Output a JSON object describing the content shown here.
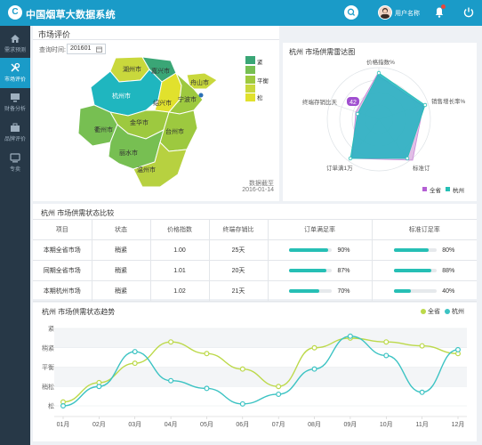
{
  "header": {
    "logo_glyph": "C",
    "title": "中国烟草大数据系统",
    "username": "用户名称",
    "accent": "#1a9bc8"
  },
  "sidebar": {
    "items": [
      {
        "label": "需求预测",
        "icon": "home-icon",
        "active": false
      },
      {
        "label": "市场评价",
        "icon": "tools-icon",
        "active": true
      },
      {
        "label": "财备分析",
        "icon": "monitor-icon",
        "active": false
      },
      {
        "label": "品牌评价",
        "icon": "briefcase-icon",
        "active": false
      },
      {
        "label": "专卖",
        "icon": "display-icon",
        "active": false
      }
    ]
  },
  "section": {
    "title": "市场评价"
  },
  "query": {
    "label": "查询时间:",
    "value": "201601"
  },
  "map": {
    "regions": [
      "湖州市",
      "嘉兴市",
      "杭州市",
      "舟山市",
      "绍兴市",
      "宁波市",
      "金华市",
      "衢州市",
      "台州市",
      "丽水市",
      "温州市"
    ],
    "legend": [
      {
        "label": "紧",
        "color": "#3aa676"
      },
      {
        "label": "",
        "color": "#77bf52"
      },
      {
        "label": "平衡",
        "color": "#9dc93f"
      },
      {
        "label": "",
        "color": "#c9d83c"
      },
      {
        "label": "松",
        "color": "#e1e12d"
      }
    ],
    "footer_label": "数据截至",
    "footer_date": "2016-01-14"
  },
  "radar": {
    "title": "杭州 市场供需雷达图",
    "axes": [
      "价格指数%",
      "销售增长率%",
      "标准订",
      "订单满1万",
      "终端存销比天"
    ],
    "badge": "42",
    "legend": [
      {
        "label": "全省",
        "color": "#b45fd4"
      },
      {
        "label": "杭州",
        "color": "#26bfb5"
      }
    ]
  },
  "comparison": {
    "title": "杭州 市场供需状态比较",
    "columns": [
      "项目",
      "状态",
      "价格指数",
      "终端存销比",
      "订单满足率",
      "标准订足率"
    ],
    "rows": [
      {
        "item": "本期全省市场",
        "status": "稍紧",
        "price_index": "1.00",
        "ratio": "25天",
        "order_rate": "90%",
        "order_value": 90,
        "std_rate": "80%",
        "std_value": 80
      },
      {
        "item": "同期全省市场",
        "status": "稍紧",
        "price_index": "1.01",
        "ratio": "20天",
        "order_rate": "87%",
        "order_value": 87,
        "std_rate": "88%",
        "std_value": 88
      },
      {
        "item": "本期杭州市场",
        "status": "稍紧",
        "price_index": "1.02",
        "ratio": "21天",
        "order_rate": "70%",
        "order_value": 70,
        "std_rate": "40%",
        "std_value": 40
      }
    ]
  },
  "chart_data": {
    "type": "line",
    "title": "杭州 市场供需状态趋势",
    "categories": [
      "01月",
      "02月",
      "03月",
      "04月",
      "05月",
      "06月",
      "07月",
      "08月",
      "09月",
      "10月",
      "11月",
      "12月"
    ],
    "y_categories": [
      "松",
      "稍松",
      "平衡",
      "稍紧",
      "紧"
    ],
    "ylim": [
      0,
      4
    ],
    "series": [
      {
        "name": "全省",
        "color": "#bcd94a",
        "values": [
          0.2,
          1.2,
          2.2,
          3.3,
          2.7,
          1.9,
          1.0,
          3.0,
          3.5,
          3.3,
          3.1,
          2.7
        ]
      },
      {
        "name": "杭州",
        "color": "#3cc3c3",
        "values": [
          0.0,
          1.0,
          2.8,
          1.3,
          0.9,
          0.1,
          0.6,
          1.9,
          3.6,
          2.6,
          0.7,
          2.9
        ]
      }
    ],
    "legend_position": "top-right"
  }
}
